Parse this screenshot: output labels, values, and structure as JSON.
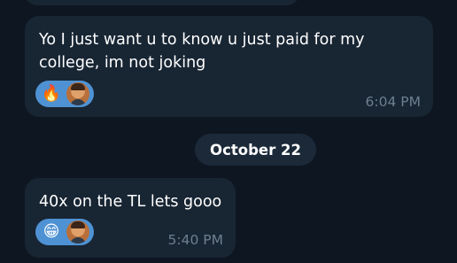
{
  "messages": [
    {
      "text": "Yo I just want u to know u just paid for my college, im not joking",
      "reactions": [
        "🔥"
      ],
      "time": "6:04 PM"
    },
    {
      "text": "40x on the TL lets gooo",
      "reactions": [
        "😁"
      ],
      "time": "5:40 PM"
    }
  ],
  "date_separator": "October 22",
  "colors": {
    "background": "#0e1621",
    "bubble": "#182533",
    "reaction_pill": "#4e92d4",
    "timestamp": "#6d7f8f"
  }
}
